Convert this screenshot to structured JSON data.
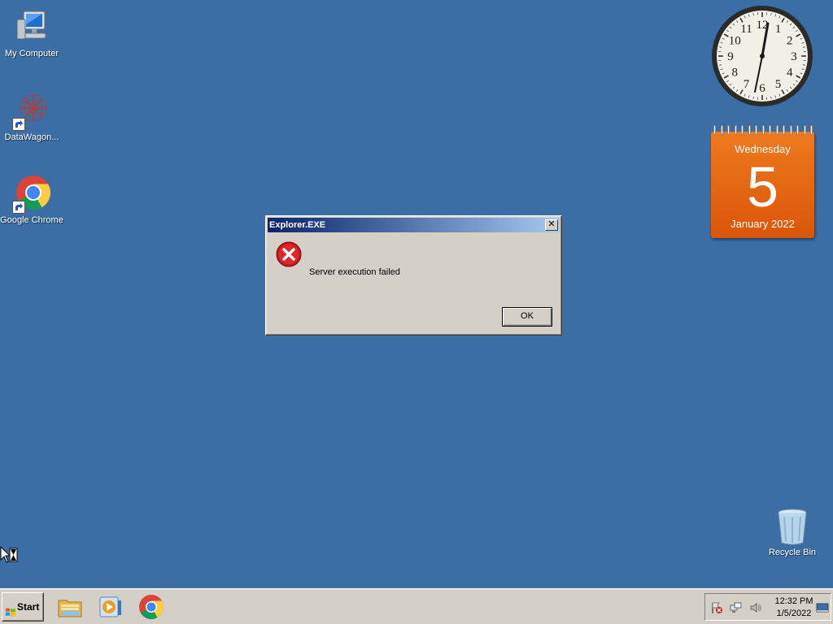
{
  "desktop": {
    "background_color": "#3a6ea5",
    "icons": [
      {
        "label": "My Computer",
        "icon": "my-computer-icon"
      },
      {
        "label": "DataWagon...",
        "icon": "datawagon-icon"
      },
      {
        "label": "Google Chrome",
        "icon": "chrome-icon"
      },
      {
        "label": "Recycle Bin",
        "icon": "recycle-bin-icon"
      }
    ]
  },
  "clock_gadget": {
    "numerals": [
      "12",
      "1",
      "2",
      "3",
      "4",
      "5",
      "6",
      "7",
      "8",
      "9",
      "10",
      "11"
    ]
  },
  "calendar_gadget": {
    "weekday": "Wednesday",
    "day": "5",
    "month_year": "January 2022",
    "color": "#e8650f"
  },
  "dialog": {
    "title": "Explorer.EXE",
    "message": "Server execution failed",
    "ok_label": "OK",
    "close_glyph": "✕",
    "icon": "error-icon"
  },
  "taskbar": {
    "start_label": "Start",
    "pinned": [
      "file-explorer-icon",
      "media-player-icon",
      "chrome-icon"
    ],
    "tray": {
      "time": "12:32 PM",
      "date": "1/5/2022",
      "icons": [
        "action-center-flag-icon",
        "network-icon",
        "volume-icon",
        "show-desktop-icon"
      ]
    }
  }
}
